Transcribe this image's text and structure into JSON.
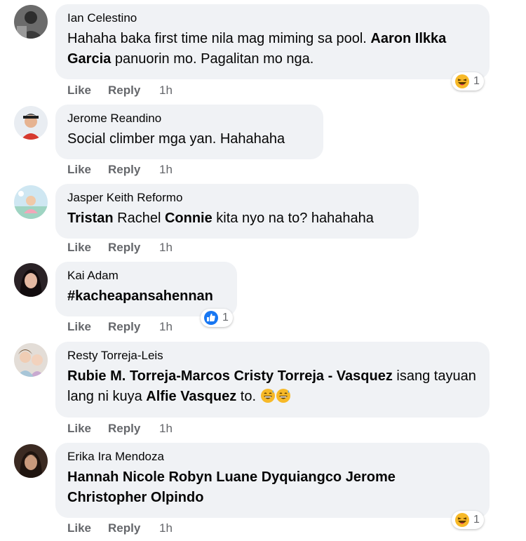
{
  "actions": {
    "like": "Like",
    "reply": "Reply"
  },
  "colors": {
    "bubble": "#f0f2f5",
    "secondary": "#65676b",
    "like_blue": "#1877f2",
    "haha_yellow": "#f7b928"
  },
  "comments": [
    {
      "author": "Ian Celestino",
      "avatar_icon": "user-photo-icon",
      "segments": [
        {
          "text": "Hahaha baka first time nila mag miming sa pool. "
        },
        {
          "text": "Aaron Ilkka Garcia",
          "tag": true
        },
        {
          "text": " panuorin mo. Pagalitan mo nga."
        }
      ],
      "time": "1h",
      "reaction": {
        "type": "haha-emoji-icon",
        "count": "1"
      }
    },
    {
      "author": "Jerome Reandino",
      "avatar_icon": "user-photo-icon",
      "segments": [
        {
          "text": "Social climber mga yan. Hahahaha"
        }
      ],
      "time": "1h"
    },
    {
      "author": "Jasper Keith Reformo",
      "avatar_icon": "user-photo-icon",
      "segments": [
        {
          "text": "Tristan",
          "tag": true
        },
        {
          "text": " Rachel "
        },
        {
          "text": "Connie",
          "tag": true
        },
        {
          "text": " kita nyo na to? hahahaha"
        }
      ],
      "time": "1h"
    },
    {
      "author": "Kai Adam",
      "avatar_icon": "user-photo-icon",
      "segments": [
        {
          "text": "#kacheapansahennan",
          "tag": true
        }
      ],
      "time": "1h",
      "reaction": {
        "type": "like-thumb-icon",
        "count": "1"
      }
    },
    {
      "author": "Resty Torreja-Leis",
      "avatar_icon": "user-photo-icon",
      "segments": [
        {
          "text": "Rubie M. Torreja-Marcos",
          "tag": true
        },
        {
          "text": " "
        },
        {
          "text": "Cristy Torreja - Vasquez",
          "tag": true
        },
        {
          "text": " isang tayuan lang ni kuya "
        },
        {
          "text": "Alfie Vasquez",
          "tag": true
        },
        {
          "text": " to. "
        }
      ],
      "inline_emojis": [
        "grinning-sweat-emoji-icon",
        "grinning-sweat-emoji-icon"
      ],
      "time": "1h"
    },
    {
      "author": "Erika Ira Mendoza",
      "avatar_icon": "user-photo-icon",
      "segments": [
        {
          "text": "Hannah Nicole Robyn Luane Dyquiangco",
          "tag": true
        },
        {
          "text": " "
        },
        {
          "text": "Jerome Christopher Olpindo",
          "tag": true
        }
      ],
      "time": "1h",
      "reaction": {
        "type": "haha-emoji-icon",
        "count": "1"
      }
    }
  ]
}
